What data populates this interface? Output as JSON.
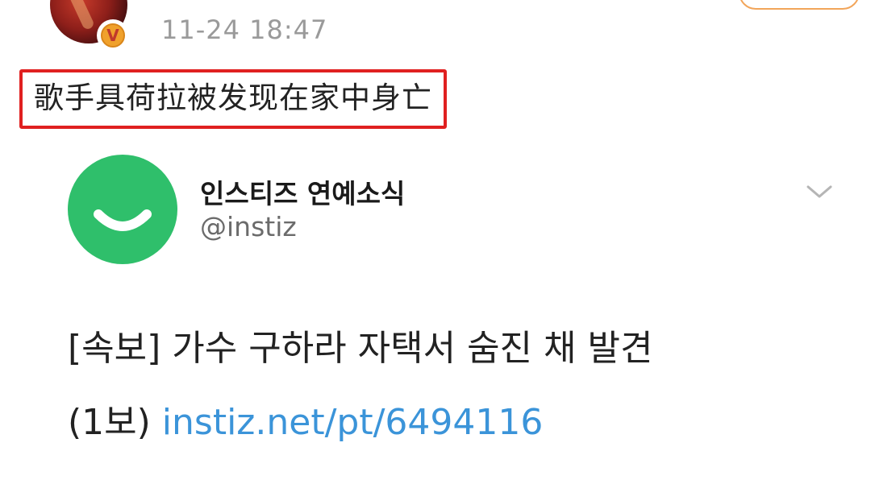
{
  "post": {
    "timestamp": "11-24 18:47",
    "verified_badge": "V",
    "text": "歌手具荷拉被发现在家中身亡",
    "highlight_color": "#e02020"
  },
  "embedded_tweet": {
    "account_name": "인스티즈 연예소식",
    "handle": "@instiz",
    "logo_color": "#2fbf6b",
    "line1": "[속보] 가수 구하라 자택서 숨진 채 발견",
    "line2_prefix": "(1보) ",
    "link": "instiz.net/pt/6494116",
    "link_color": "#3b94d9"
  },
  "icons": {
    "avatar": "user-avatar",
    "badge": "verified-badge-icon",
    "logo": "instiz-logo-icon",
    "menu": "chevron-down-icon"
  }
}
